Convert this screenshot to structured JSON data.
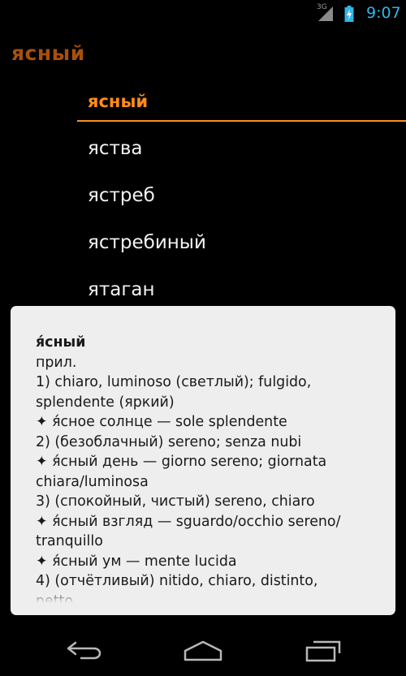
{
  "status_bar": {
    "network_label": "3G",
    "time": "9:07"
  },
  "header": {
    "title": "ясный"
  },
  "word_list": [
    "ясный",
    "яства",
    "ястреб",
    "ястребиный",
    "ятаган"
  ],
  "definition": {
    "headword": "я́сный",
    "lines": [
      "прил.",
      "1) chiaro, luminoso (светлый); fulgido,",
      "splendente (яркий)",
      "✦ я́сное солнце — sole splendente",
      "2) (безоблачный) sereno; senza nubi",
      "✦ я́сный день — giorno sereno; giornata",
      "chiara/luminosa",
      "3) (спокойный, чистый) sereno, chiaro",
      "✦ я́сный взгляд — sguardo/occhio sereno/",
      "tranquillo",
      "✦ я́сный ум — mente lucida",
      "4) (отчётливый) nitido, chiaro, distinto,",
      "netto"
    ]
  },
  "nav": {
    "back_icon": "back-arrow",
    "home_icon": "home",
    "recent_icon": "recent-apps"
  }
}
